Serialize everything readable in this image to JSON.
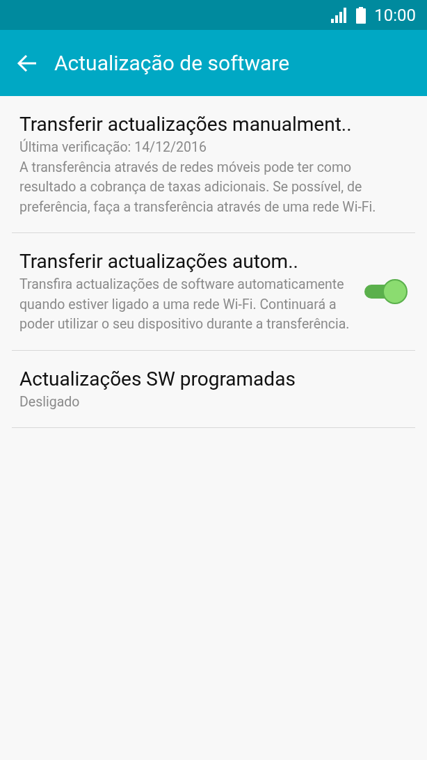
{
  "status_bar": {
    "time": "10:00"
  },
  "app_bar": {
    "title": "Actualização de software"
  },
  "settings": [
    {
      "kind": "plain",
      "title": "Transferir actualizações manualment..",
      "lines": [
        "Última verificação: 14/12/2016",
        "A transferência através de redes móveis pode ter como resultado a cobrança de taxas adicionais. Se possível, de preferência, faça a transferência através de uma rede Wi-Fi."
      ]
    },
    {
      "kind": "switch",
      "title": "Transferir actualizações autom..",
      "lines": [
        "Transfira actualizações de software automaticamente quando estiver ligado a uma rede Wi-Fi. Continuará a poder utilizar o seu dispositivo durante a transferência."
      ],
      "on": true
    },
    {
      "kind": "plain",
      "title": "Actualizações SW programadas",
      "lines": [
        "Desligado"
      ]
    }
  ]
}
